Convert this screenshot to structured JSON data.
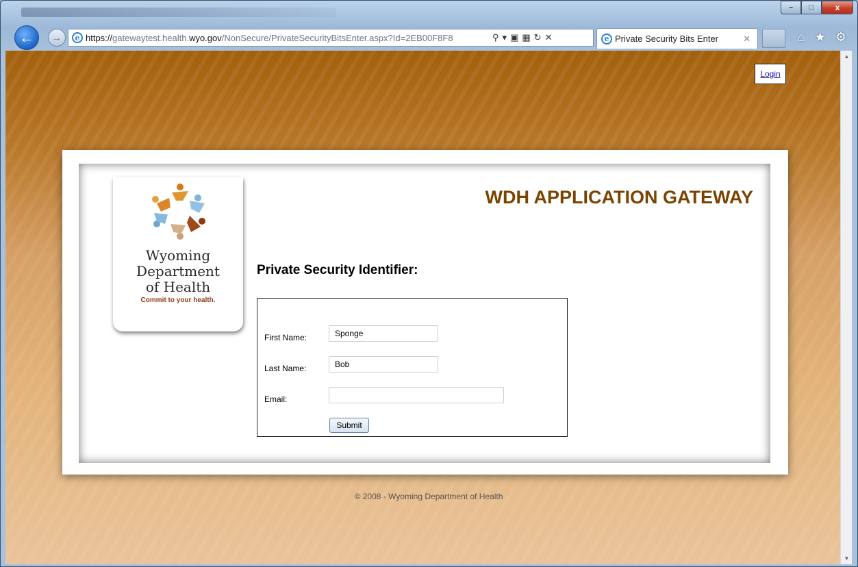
{
  "browser": {
    "address_url_prefix": "https://",
    "address_url_sub": "gatewaytest.health.",
    "address_url_domain": "wyo.gov",
    "address_url_path": "/NonSecure/PrivateSecurityBitsEnter.aspx?Id=2EB00F8F8",
    "tab_title": "Private Security Bits Enter",
    "window_minimize": "–",
    "window_maximize": "□",
    "window_close": "x"
  },
  "page": {
    "login_link": "Login",
    "logo": {
      "line1": "Wyoming",
      "line2": "Department",
      "line3": "of Health",
      "tagline": "Commit to your health."
    },
    "gateway_title": "WDH APPLICATION GATEWAY",
    "form_heading": "Private Security Identifier:",
    "form": {
      "first_name_label": "First Name:",
      "first_name_value": "Sponge",
      "last_name_label": "Last Name:",
      "last_name_value": "Bob",
      "email_label": "Email:",
      "email_value": "",
      "submit_label": "Submit"
    },
    "footer": "© 2008 - Wyoming Department of Health"
  },
  "colors": {
    "title_color": "#7a4400",
    "tagline_color": "#8a3a12",
    "page_background_top": "#a3600c",
    "page_background_bottom": "#e9c39a"
  }
}
